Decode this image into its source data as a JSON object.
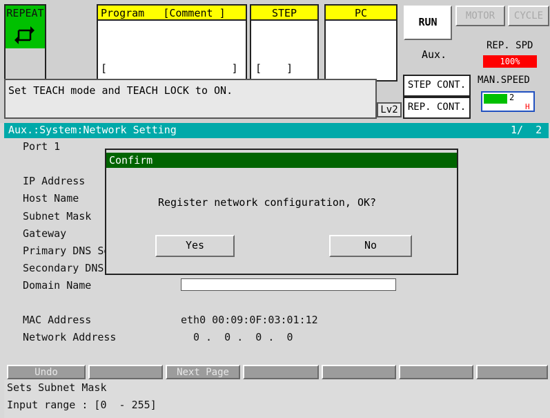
{
  "mode": {
    "label": "REPEAT",
    "icon": "repeat-cycle-icon"
  },
  "program": {
    "label": "Program",
    "comment_label": "[Comment ]",
    "value": "[                    ]"
  },
  "step": {
    "label": "STEP",
    "value": "[    ]"
  },
  "pc": {
    "label": "PC"
  },
  "status_buttons": {
    "run": "RUN",
    "motor": "MOTOR",
    "cycle": "CYCLE"
  },
  "aux_label": "Aux.",
  "rep_spd": {
    "label": "REP. SPD",
    "value": "100%"
  },
  "man_speed": {
    "label": "MAN.SPEED",
    "value": "2",
    "marker": "H"
  },
  "step_cont": "STEP CONT.",
  "rep_cont": "REP. CONT.",
  "level": "Lv2",
  "message": "Set TEACH mode and TEACH LOCK to ON.",
  "screen": {
    "title": "Aux.:System:Network Setting",
    "page": "1/  2"
  },
  "fields": {
    "port": "Port 1",
    "ip": "IP Address",
    "host": "Host Name",
    "subnet": "Subnet Mask",
    "gateway": "Gateway",
    "dns1": "Primary DNS Server",
    "dns2": "Secondary DNS Server",
    "domain": "Domain Name",
    "mac": "MAC Address",
    "mac_value": "eth0 00:09:0F:03:01:12",
    "network": "Network Address",
    "network_value": "0 .  0 .  0 .  0"
  },
  "dialog": {
    "title": "Confirm",
    "message": "Register network configuration, OK?",
    "yes": "Yes",
    "no": "No"
  },
  "function_keys": [
    "Undo",
    "",
    "Next Page",
    "",
    "",
    "",
    "",
    ""
  ],
  "help": {
    "line1": "Sets Subnet Mask",
    "line2": "Input range : [0  - 255]"
  },
  "colors": {
    "green": "#00c000",
    "yellow": "#ffff00",
    "teal": "#00a9a9",
    "dialog_title": "#006400",
    "red": "#ff0000"
  }
}
